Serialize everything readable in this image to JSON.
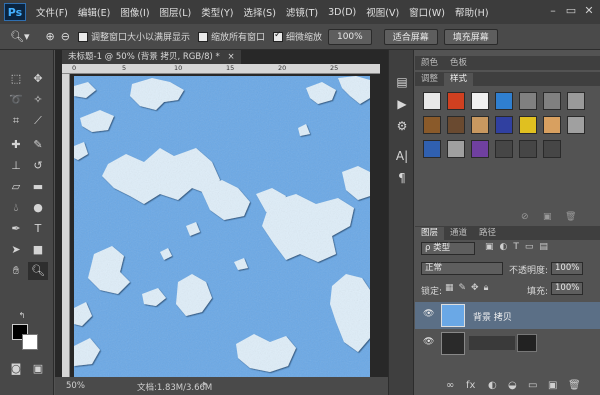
{
  "app": {
    "logo": "Ps",
    "menu": [
      "文件(F)",
      "编辑(E)",
      "图像(I)",
      "图层(L)",
      "类型(Y)",
      "选择(S)",
      "滤镜(T)",
      "3D(D)",
      "视图(V)",
      "窗口(W)",
      "帮助(H)"
    ],
    "window_controls": [
      "–",
      "▭",
      "✕"
    ]
  },
  "options_bar": {
    "resize_windows_label": "调整窗口大小以满屏显示",
    "zoom_all_label": "缩放所有窗口",
    "scrubby_zoom_label": "细微缩放",
    "zoom_percent_button": "100%",
    "fit_screen_button": "适合屏幕",
    "fill_screen_button": "填充屏幕",
    "resize_checked": false,
    "zoom_all_checked": false,
    "scrubby_checked": true
  },
  "document": {
    "tab_title": "未标题-1 @ 50% (背景 拷贝, RGB/8) *",
    "tab_close": "×",
    "ruler_marks": [
      "0",
      "5",
      "10",
      "15",
      "20",
      "25"
    ],
    "zoom_level": "50%",
    "doc_info": "文档:1.83M/3.66M",
    "canvas_color": "#6aa8e6",
    "island_color": "#dfeef9"
  },
  "panels": {
    "top_tabs": [
      "颜色",
      "色板"
    ],
    "top_tabs2": [
      "调整",
      "样式"
    ],
    "styles_swatch_colors": [
      [
        "#e8e8e8",
        "#d04020",
        "#f0f0f0",
        "#2f7fd0",
        "#808080",
        "#808080",
        "#9a9a9a"
      ],
      [
        "#8a5a2a",
        "#6a4a30",
        "#c89860",
        "#3040a0",
        "#e0c020",
        "#d8a060",
        "#a0a0a0"
      ],
      [
        "#3060b0",
        "#a0a0a0",
        "#7040a0",
        "#464646",
        "#464646",
        "#464646",
        ""
      ]
    ],
    "layers_tabs": [
      "图层",
      "通道",
      "路径"
    ],
    "kind_filter": "ρ 类型",
    "blend_mode": "正常",
    "opacity_label": "不透明度:",
    "opacity_value": "100%",
    "lock_label": "锁定:",
    "fill_label": "填充:",
    "fill_value": "100%",
    "layers": [
      {
        "name": "背景 拷贝",
        "selected": true
      },
      {
        "name": "",
        "selected": false
      }
    ],
    "bottom_icons": [
      "∞",
      "fx",
      "◐",
      "◒",
      "▭",
      "▣",
      "🗑"
    ]
  }
}
